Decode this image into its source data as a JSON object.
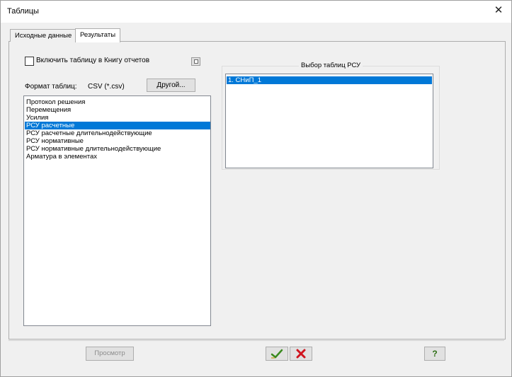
{
  "window": {
    "title": "Таблицы",
    "close_glyph": "✕"
  },
  "tabs": [
    {
      "label": "Исходные данные",
      "active": false
    },
    {
      "label": "Результаты",
      "active": true
    }
  ],
  "report": {
    "include_label": "Включить таблицу в Книгу отчетов",
    "checked": false
  },
  "format": {
    "label": "Формат таблиц:",
    "value": "CSV (*.csv)",
    "other_button": "Другой..."
  },
  "tables_list": {
    "items": [
      "Протокол решения",
      "Перемещения",
      "Усилия",
      "РСУ расчетные",
      "РСУ расчетные длительнодействующие",
      "РСУ нормативные",
      "РСУ нормативные длительнодействующие",
      "Арматура в элементах"
    ],
    "selected_index": 3
  },
  "rsu_group": {
    "title": "Выбор таблиц РСУ",
    "items": [
      "1. СНиП_1"
    ]
  },
  "buttons": {
    "preview": "Просмотр",
    "help": "?"
  },
  "icons": {
    "ok": "checkmark-icon",
    "cancel": "red-x-icon",
    "report": "book-icon"
  },
  "colors": {
    "selection": "#0078d7",
    "ok_green": "#3a8a1f",
    "cancel_red": "#d0141e",
    "help_green": "#2d6e14"
  }
}
